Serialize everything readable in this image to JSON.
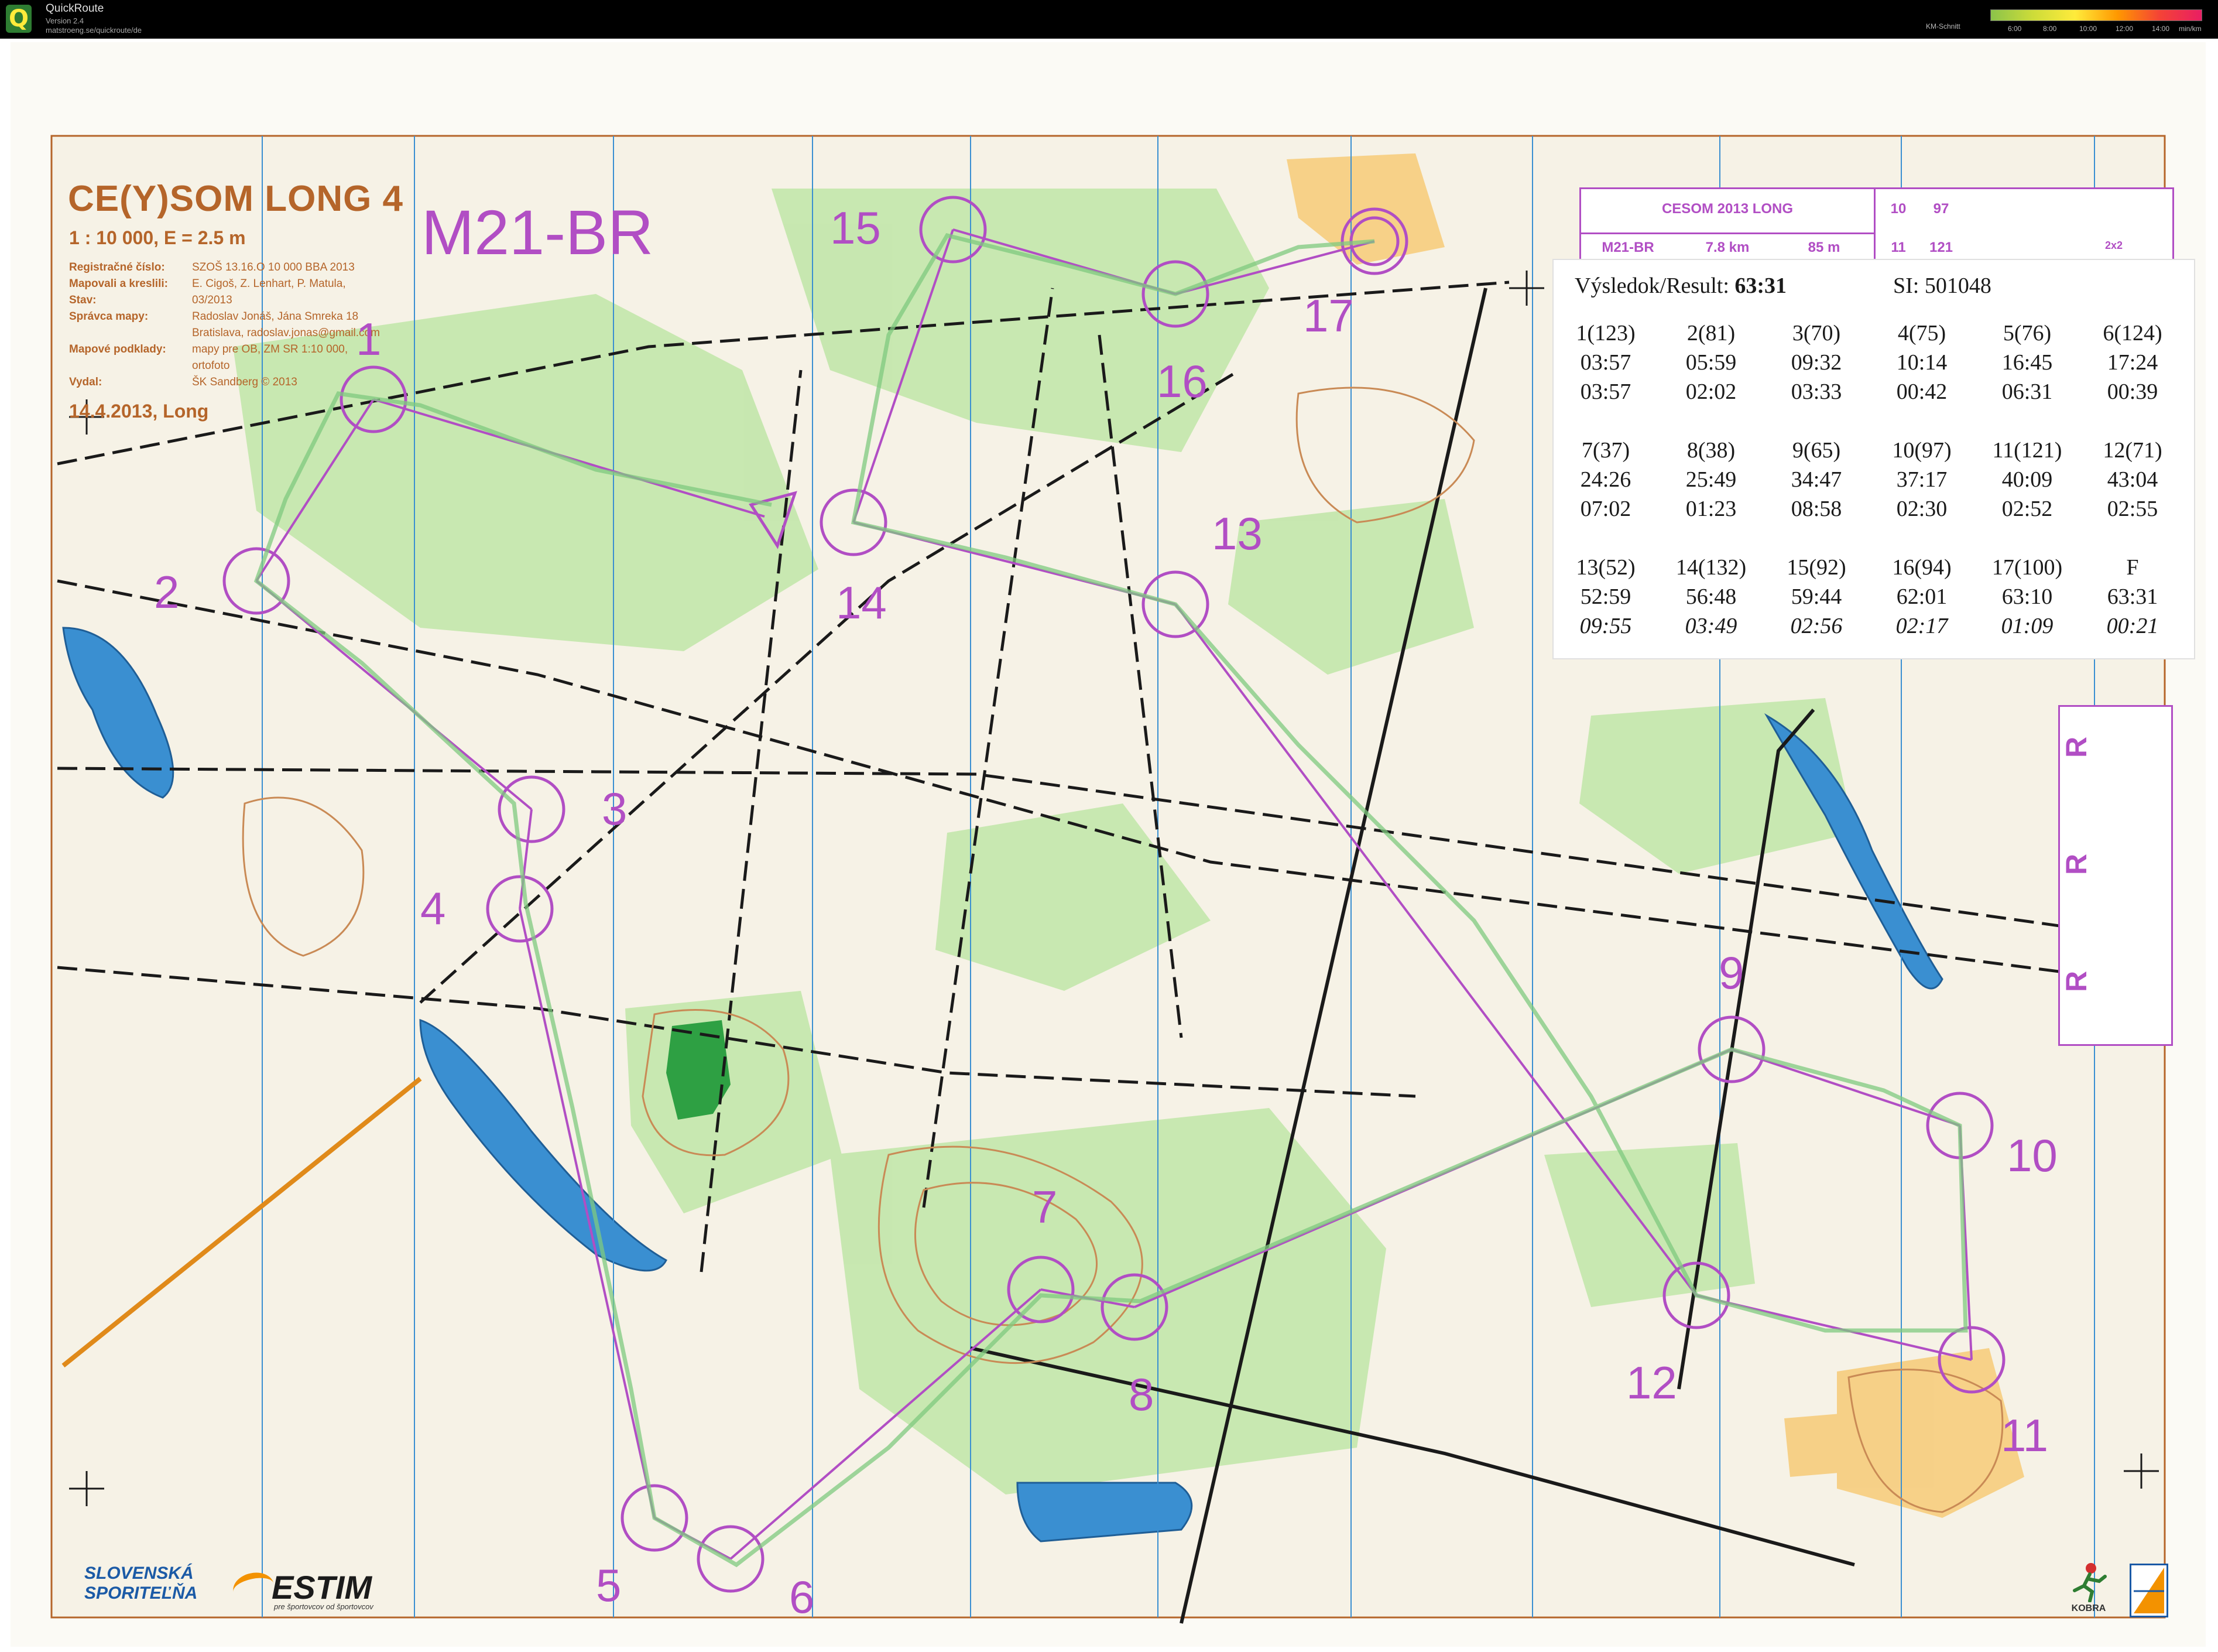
{
  "window": {
    "app_name": "QuickRoute",
    "version": "Version 2.4",
    "url": "matstroeng.se/quickroute/de",
    "speed_legend": {
      "label": "KM-Schnitt",
      "ticks": [
        "6:00",
        "8:00",
        "10:00",
        "12:00",
        "14:00",
        "min/km"
      ]
    }
  },
  "map": {
    "title": "CE(Y)SOM LONG 4",
    "scale": "1 : 10 000, E = 2.5 m",
    "meta": [
      {
        "key": "Registračné číslo:",
        "value": "SZOŠ 13.16.O 10 000 BBA 2013"
      },
      {
        "key": "Mapovali a kreslili:",
        "value": "E. Cigoš, Z. Lenhart, P. Matula,"
      },
      {
        "key": "Stav:",
        "value": "03/2013"
      },
      {
        "key": "Správca mapy:",
        "value": "Radoslav Jonáš, Jána Smreka 18"
      },
      {
        "key": "",
        "value": "Bratislava, radoslav.jonas@gmail.com"
      },
      {
        "key": "Mapové podklady:",
        "value": "mapy pre OB, ZM SR 1:10 000,"
      },
      {
        "key": "",
        "value": "ortofoto"
      },
      {
        "key": "Vydal:",
        "value": "ŠK Sandberg © 2013"
      }
    ],
    "date": "14.4.2013, Long",
    "course_name": "M21-BR",
    "controls": [
      "1",
      "2",
      "3",
      "4",
      "5",
      "6",
      "7",
      "8",
      "9",
      "10",
      "11",
      "12",
      "13",
      "14",
      "15",
      "16",
      "17"
    ]
  },
  "description_box": {
    "event": "CESOM 2013 LONG",
    "course": "M21-BR",
    "length": "7.8 km",
    "climb": "85 m",
    "rows": [
      {
        "num": "10",
        "code": "97"
      },
      {
        "num": "11",
        "code": "121"
      }
    ],
    "extra": "2x2"
  },
  "result": {
    "label": "Výsledok/Result:",
    "time": "63:31",
    "si_label": "SI:",
    "si_number": "501048",
    "splits": [
      {
        "ctrl": "1(123)",
        "cum": "03:57",
        "leg": "03:57"
      },
      {
        "ctrl": "2(81)",
        "cum": "05:59",
        "leg": "02:02"
      },
      {
        "ctrl": "3(70)",
        "cum": "09:32",
        "leg": "03:33"
      },
      {
        "ctrl": "4(75)",
        "cum": "10:14",
        "leg": "00:42"
      },
      {
        "ctrl": "5(76)",
        "cum": "16:45",
        "leg": "06:31"
      },
      {
        "ctrl": "6(124)",
        "cum": "17:24",
        "leg": "00:39"
      },
      {
        "ctrl": "7(37)",
        "cum": "24:26",
        "leg": "07:02"
      },
      {
        "ctrl": "8(38)",
        "cum": "25:49",
        "leg": "01:23"
      },
      {
        "ctrl": "9(65)",
        "cum": "34:47",
        "leg": "08:58"
      },
      {
        "ctrl": "10(97)",
        "cum": "37:17",
        "leg": "02:30"
      },
      {
        "ctrl": "11(121)",
        "cum": "40:09",
        "leg": "02:52"
      },
      {
        "ctrl": "12(71)",
        "cum": "43:04",
        "leg": "02:55"
      },
      {
        "ctrl": "13(52)",
        "cum": "52:59",
        "leg": "09:55"
      },
      {
        "ctrl": "14(132)",
        "cum": "56:48",
        "leg": "03:49"
      },
      {
        "ctrl": "15(92)",
        "cum": "59:44",
        "leg": "02:56"
      },
      {
        "ctrl": "16(94)",
        "cum": "62:01",
        "leg": "02:17"
      },
      {
        "ctrl": "17(100)",
        "cum": "63:10",
        "leg": "01:09"
      },
      {
        "ctrl": "F",
        "cum": "63:31",
        "leg": "00:21"
      }
    ]
  },
  "side_box": {
    "letters": [
      "R",
      "R",
      "R"
    ]
  },
  "sponsors": {
    "sporitelna_line1": "SLOVENSKÁ",
    "sporitelna_line2": "SPORITEĽŇA",
    "estim": "ESTIM",
    "estim_sub": "pre športovcov od športovcov",
    "kobra": "KOBRA"
  },
  "colors": {
    "course_purple": "#b14ec4",
    "contour_brown": "#b5652a",
    "forest_green": "#a6dc8a",
    "water_blue": "#3a8fd1",
    "open_yellow": "#f7c870"
  }
}
